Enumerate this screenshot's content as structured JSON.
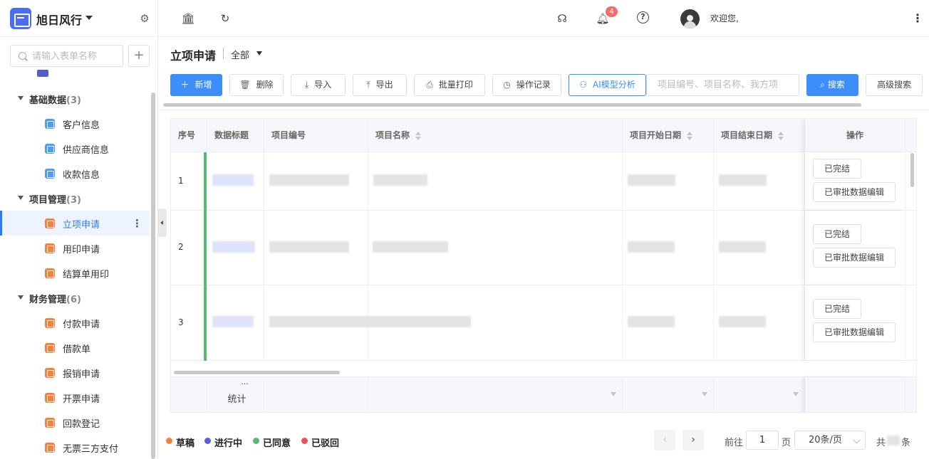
{
  "brand": {
    "name": "旭日风行"
  },
  "sidebar": {
    "search_placeholder": "请输入表单名称",
    "add_label": "+",
    "groups": [
      {
        "label": "基础数据",
        "count": "(3)",
        "items": [
          "客户信息",
          "供应商信息",
          "收款信息"
        ]
      },
      {
        "label": "项目管理",
        "count": "(3)",
        "items": [
          "立项申请",
          "用印申请",
          "结算单用印"
        ]
      },
      {
        "label": "财务管理",
        "count": "(6)",
        "items": [
          "付款申请",
          "借款单",
          "报销申请",
          "开票申请",
          "回款登记",
          "无票三方支付"
        ]
      }
    ]
  },
  "header": {
    "notif_count": "4",
    "welcome": "欢迎您,",
    "menu_glyph": "⋮"
  },
  "page": {
    "title": "立项申请",
    "filter": "全部"
  },
  "toolbar": {
    "add": "新增",
    "delete": "删除",
    "import": "导入",
    "export": "导出",
    "batch_print": "批量打印",
    "log": "操作记录",
    "ai": "AI模型分析",
    "search_placeholder": "项目编号、项目名称、我方项",
    "search": "搜索",
    "advanced": "高级搜索"
  },
  "table": {
    "headers": [
      "序号",
      "数据标题",
      "项目编号",
      "项目名称",
      "项目开始日期",
      "项目结束日期",
      "操作"
    ],
    "rows": [
      {
        "index": "1"
      },
      {
        "index": "2"
      },
      {
        "index": "3"
      }
    ],
    "row_actions": [
      "已完结",
      "已审批数据编辑"
    ],
    "footer_label": "统计",
    "footer_dots": "...",
    "status_colors": {
      "agreed": "#5cb87a"
    }
  },
  "legend": [
    {
      "label": "草稿",
      "color": "#f7803a"
    },
    {
      "label": "进行中",
      "color": "#5b5fd6"
    },
    {
      "label": "已同意",
      "color": "#5cb87a"
    },
    {
      "label": "已驳回",
      "color": "#f0505e"
    }
  ],
  "pagination": {
    "prev": "‹",
    "next": "›",
    "goto_label": "前往",
    "page": "1",
    "page_unit": "页",
    "page_size": "20条/页",
    "total_prefix": "共",
    "total_suffix": "条"
  }
}
